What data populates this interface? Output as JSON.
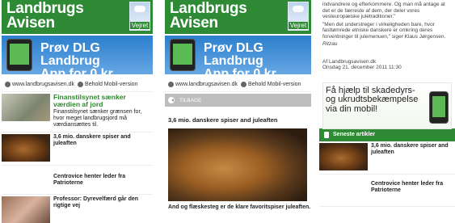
{
  "brand": {
    "line1": "Landbrugs",
    "line2": "Avisen",
    "weather": "Vejret"
  },
  "ad": {
    "line1": "Prøv DLG Landbrug",
    "line2": "App for 0 kr."
  },
  "urlbar": {
    "site": "www.landbrugsavisen.dk",
    "mobile": "Behold Mobil-version"
  },
  "list": [
    {
      "title": "Finanstilsynet sænker værdien af jord",
      "sub": "Finanstilsynet sænker grænsen for, hvor meget landbrugsjord må værdiansættes til."
    },
    {
      "title": "3,6 mio. danskere spiser and juleaften",
      "sub": ""
    },
    {
      "title": "Centrovice henter leder fra Patrioterne",
      "sub": ""
    },
    {
      "title": "Professor: Dyrevelfærd går den rigtige vej",
      "sub": ""
    }
  ],
  "detail": {
    "back": "TILBAGE",
    "title": "3,6 mio. danskere spiser and juleaften",
    "caption": "And og flæskesteg er de klare favoritspiser juleaften."
  },
  "continuation": {
    "para1": "indvandrere og efterkommere. Og man må antage at det er de færreste af dem, der deler vores vesteuropæiske juletraditioner.\"",
    "para2": "\"Men det understreger i virkeligheden bare, hvor fasttømrede etniske danskere er omkring deres forventninger til julemenuen,\" siger Klaus Jørgensen.",
    "source": "Ritzau",
    "byline": "Af Landbrugsavisen.dk",
    "date": "Onsdag 21. december 2011 11:30",
    "ad_text": "Få hjælp til skadedyrs- og ukrudtsbekæmpelse via din mobil!",
    "latest": "Seneste artikler",
    "latest_items": [
      {
        "title": "3,6 mio. danskere spiser and juleaften"
      },
      {
        "title": "Centrovice henter leder fra Patrioterne"
      }
    ]
  }
}
